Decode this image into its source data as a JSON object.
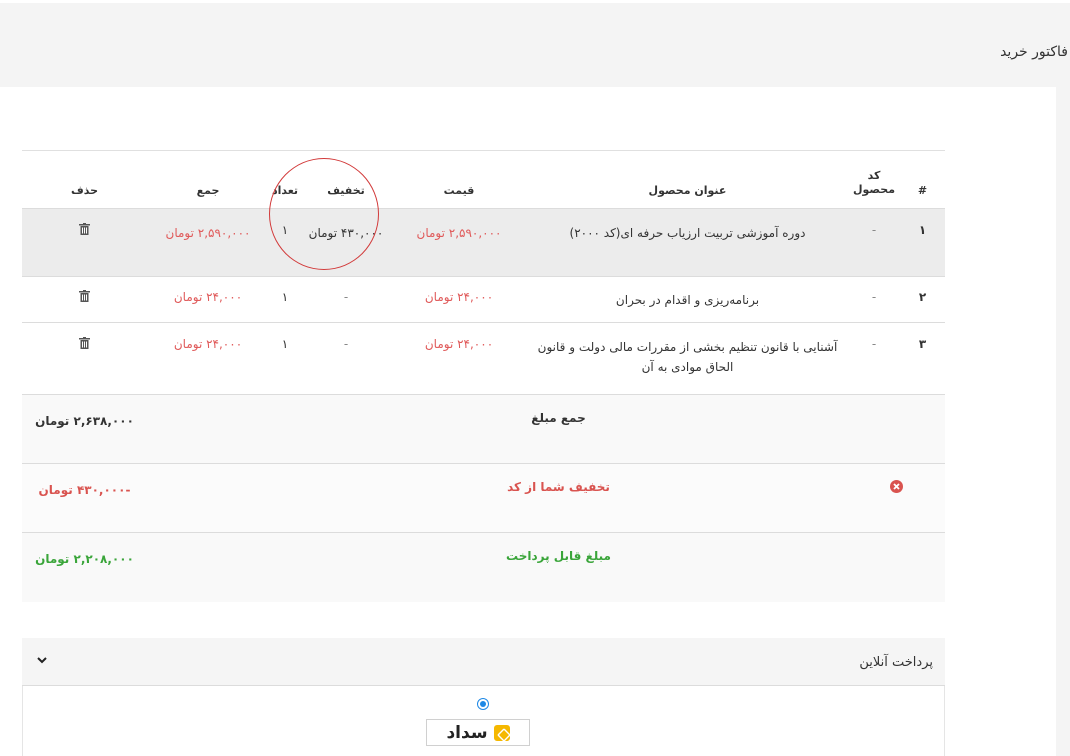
{
  "page": {
    "title": "فاکتور خرید"
  },
  "table": {
    "headers": {
      "index": "#",
      "code": "کد محصول",
      "title": "عنوان محصول",
      "price": "قیمت",
      "discount": "تخفیف",
      "qty": "تعداد",
      "total": "جمع",
      "delete": "حذف"
    },
    "rows": [
      {
        "index": "۱",
        "code": "-",
        "title": "دوره آموزشی تربیت ارزیاب حرفه ای(کد ۲۰۰۰)",
        "price": "۲,۵۹۰,۰۰۰ تومان",
        "discount": "۴۳۰,۰۰۰ تومان",
        "qty": "۱",
        "total": "۲,۵۹۰,۰۰۰ تومان"
      },
      {
        "index": "۲",
        "code": "-",
        "title": "برنامه‌ریزی و اقدام در بحران",
        "price": "۲۴,۰۰۰ تومان",
        "discount": "-",
        "qty": "۱",
        "total": "۲۴,۰۰۰ تومان"
      },
      {
        "index": "۳",
        "code": "-",
        "title": "آشنایی با قانون تنظیم بخشی از مقررات مالی دولت و قانون الحاق موادی به آن",
        "price": "۲۴,۰۰۰ تومان",
        "discount": "-",
        "qty": "۱",
        "total": "۲۴,۰۰۰ تومان"
      }
    ],
    "summary": {
      "subtotal_label": "جمع مبلغ",
      "subtotal_value": "۲,۶۳۸,۰۰۰ تومان",
      "discount_label": "تخفیف شما از کد",
      "discount_value": "-۴۳۰,۰۰۰ تومان",
      "payable_label": "مبلغ قابل پرداخت",
      "payable_value": "۲,۲۰۸,۰۰۰ تومان"
    }
  },
  "payment": {
    "title": "پرداخت آنلاین",
    "gateway_name": "سداد"
  },
  "colors": {
    "accent_red": "#e05a5a",
    "green": "#3aa53a",
    "annotation": "#d23a3a",
    "radio": "#1e88e5"
  }
}
